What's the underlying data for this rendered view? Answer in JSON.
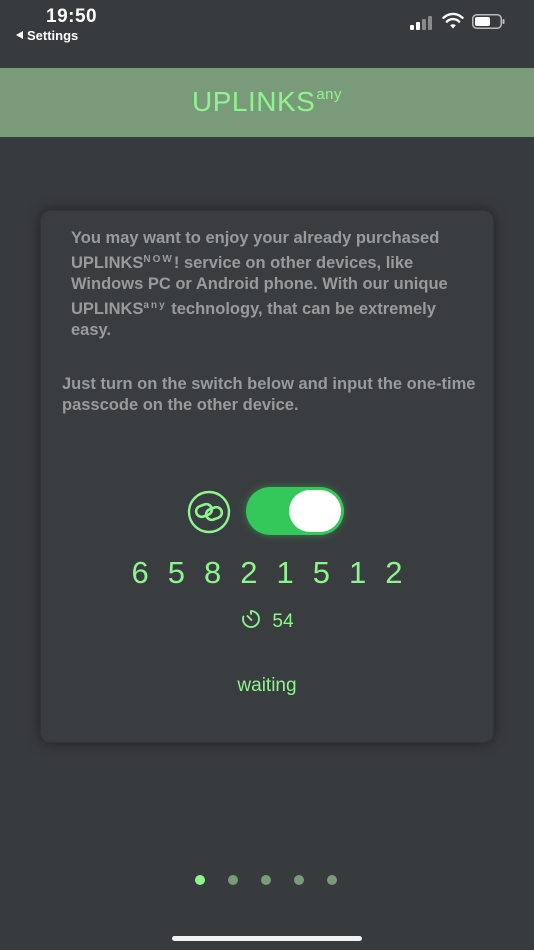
{
  "status_bar": {
    "time": "19:50",
    "back_label": "Settings"
  },
  "header": {
    "title": "UPLINKS",
    "title_sup": "any"
  },
  "card": {
    "para1_part1": "You may want to enjoy your already purchased UPLINKS",
    "para1_sup_now": "NOW",
    "para1_part2": "! service on other devices, like Windows PC or Android phone. With our unique UPLINKS",
    "para1_sup_any": "any",
    "para1_part3": " technology, that can be extremely easy.",
    "para2": "Just turn on the switch below and input the one-time passcode on the other device.",
    "switch_on": true,
    "passcode": "65821512",
    "countdown": "54",
    "status": "waiting"
  },
  "pager": {
    "count": 5,
    "active_index": 0
  },
  "icons": {
    "link": "link-icon",
    "timer": "stopwatch-icon",
    "signal": "cellular-signal-icon",
    "wifi": "wifi-icon",
    "battery": "battery-icon"
  },
  "colors": {
    "background": "#383b3e",
    "header_bg": "#7a9b7a",
    "accent": "#8ef58e",
    "switch_on": "#34c759",
    "body_text": "#9a9a9a",
    "dot_active": "#8ef58e",
    "dot_inactive": "#7a9b7a"
  }
}
